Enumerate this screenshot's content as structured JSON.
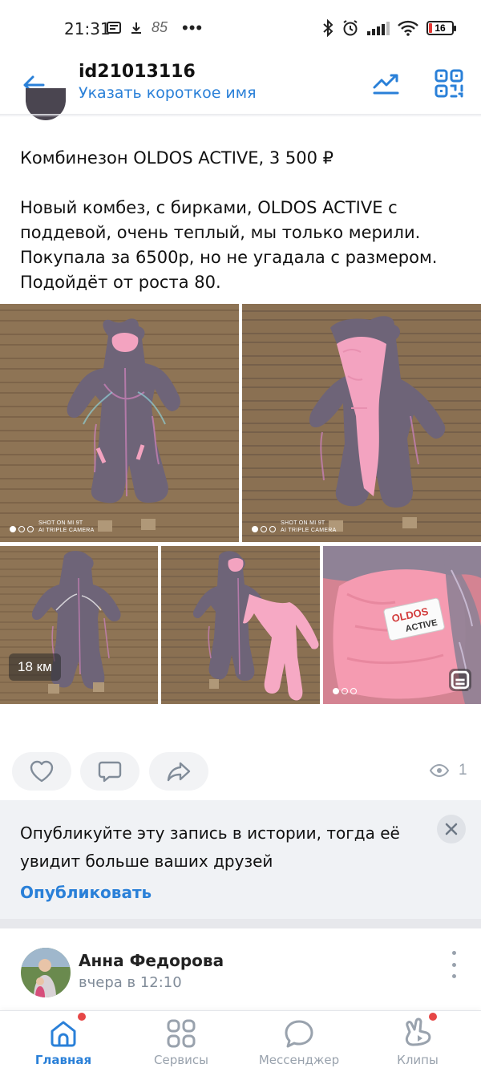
{
  "status_bar": {
    "time": "21:31",
    "left_icons": [
      "message-icon",
      "download-icon",
      "notification-85-icon",
      "more-dots-icon"
    ],
    "notification_count": "85",
    "right_icons": [
      "bluetooth-icon",
      "alarm-icon",
      "signal-icon",
      "wifi-icon"
    ],
    "battery": "16"
  },
  "header": {
    "title": "id21013116",
    "subtitle": "Указать короткое имя"
  },
  "post": {
    "title": "Комбинезон OLDOS ACTIVE, 3 500 ₽",
    "body": "Новый комбез, с бирками, OLDOS ACTIVE с поддевой, очень теплый, мы только мерили. Покупала за 6500р, но не угадала с размером. Подойдёт от роста 80.",
    "photo_caption": "SHOT ON MI 9T\nAI TRIPLE CAMERA",
    "distance_badge": "18 км",
    "views": "1"
  },
  "banner": {
    "text": "Опубликуйте эту запись в истории, тогда её увидит больше ваших друзей",
    "link": "Опубликовать"
  },
  "next_post": {
    "author": "Анна Федорова",
    "time": "вчера в 12:10"
  },
  "tabbar": {
    "items": [
      {
        "label": "Главная",
        "icon": "home-icon",
        "active": true
      },
      {
        "label": "Сервисы",
        "icon": "services-icon",
        "active": false
      },
      {
        "label": "Мессенджер",
        "icon": "messenger-icon",
        "active": false
      },
      {
        "label": "Клипы",
        "icon": "clips-icon",
        "active": false
      }
    ]
  },
  "colors": {
    "accent": "#2a80d8",
    "suit_purple": "#6e6478",
    "suit_pink": "#f3a3c0",
    "floor": "#8c7154",
    "notification_dot": "#e64646"
  }
}
